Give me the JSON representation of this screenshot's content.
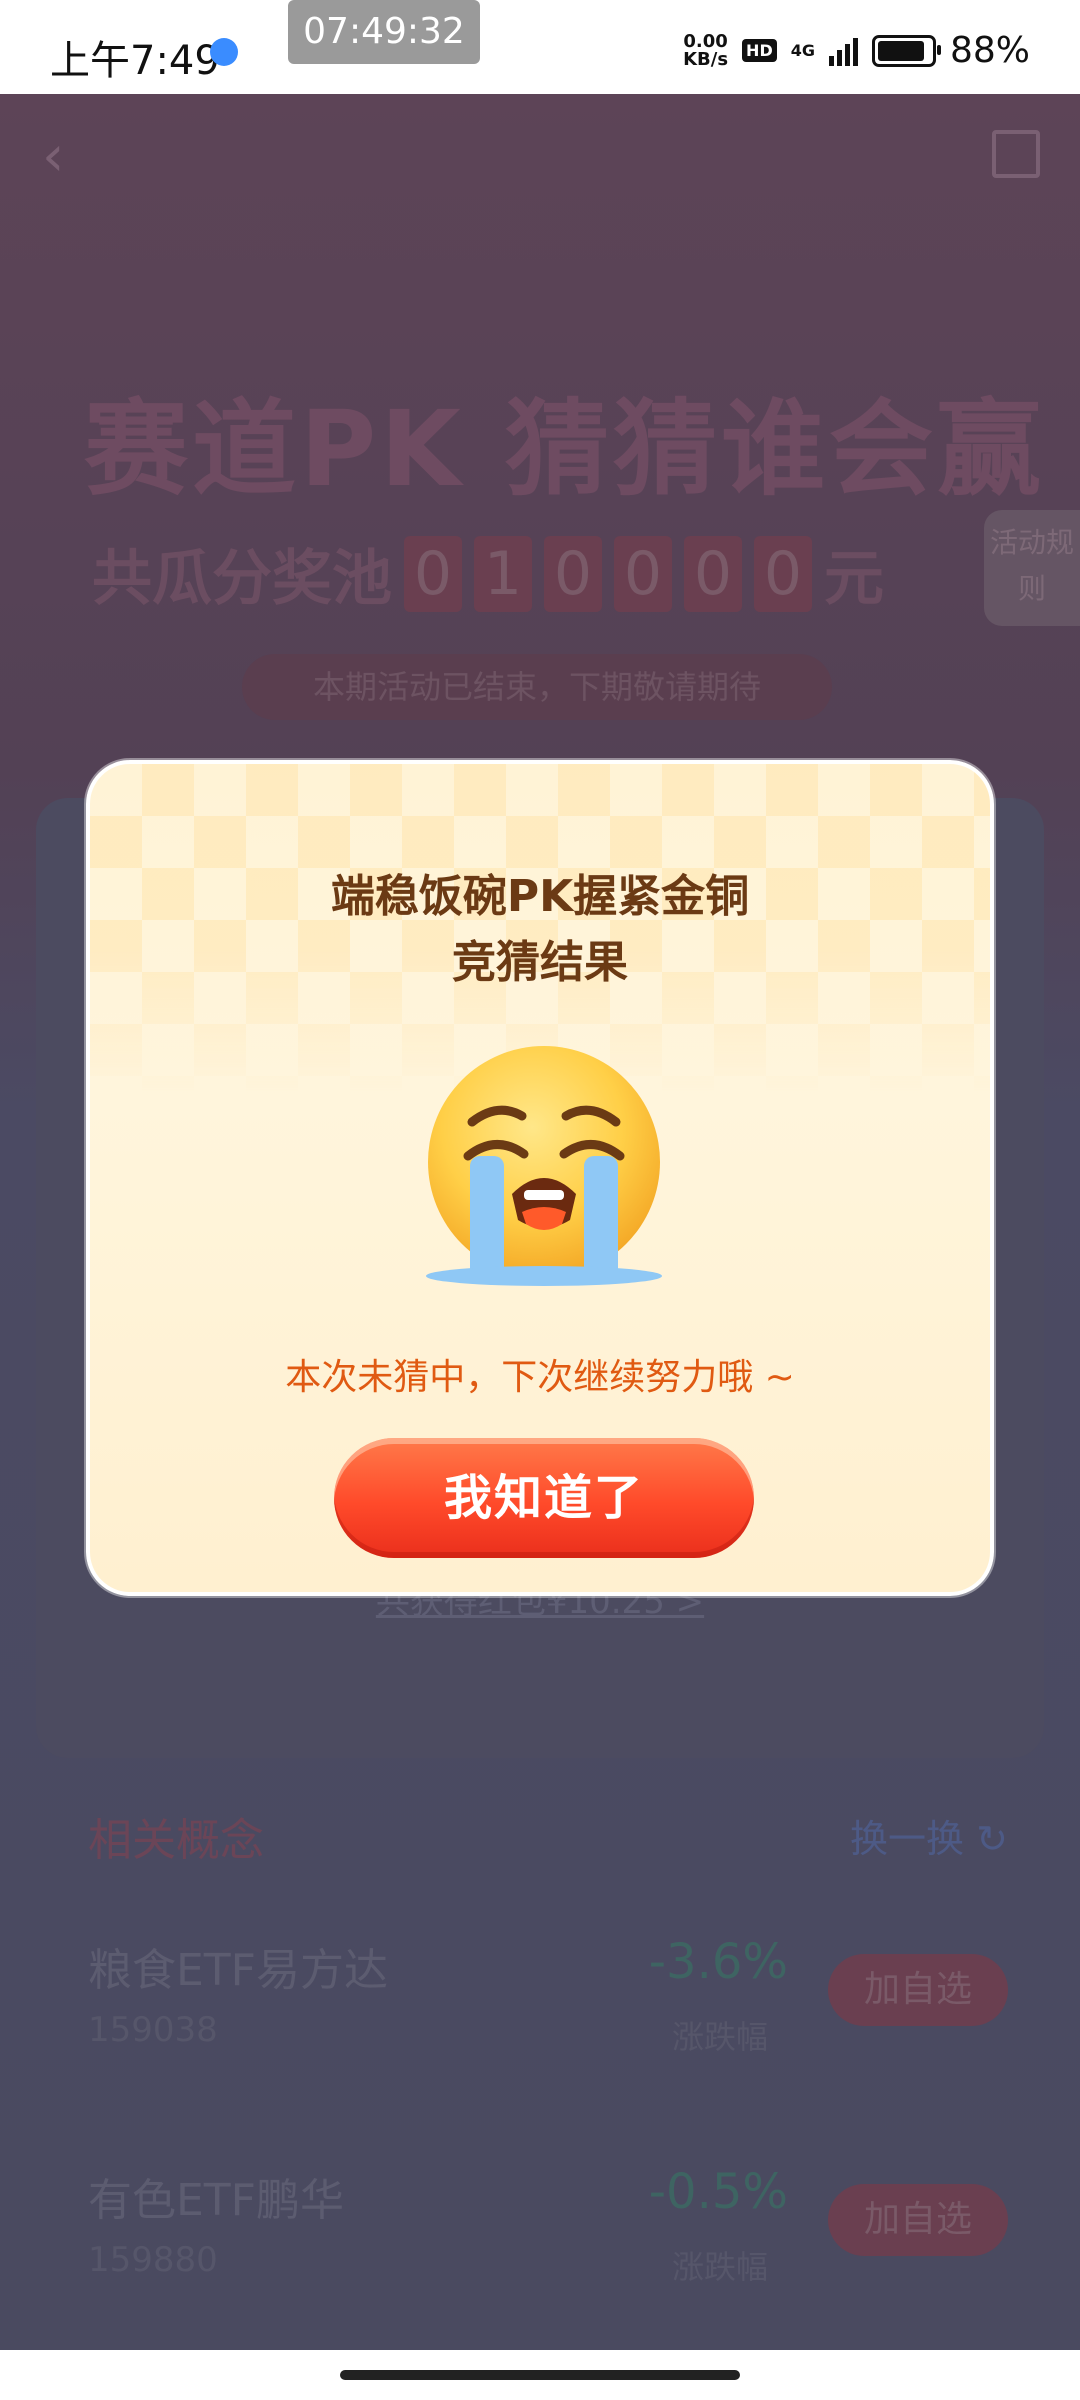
{
  "status_bar": {
    "time": "上午7:49",
    "clock_overlay": "07:49:32",
    "net_speed_value": "0.00",
    "net_speed_unit": "KB/s",
    "hd": "HD",
    "network": "4G",
    "battery_percent_text": "88%",
    "battery_level": 0.88
  },
  "background_page": {
    "brand": "",
    "title": "赛道PK 猜猜谁会赢",
    "pool_label": "共瓜分奖池",
    "pool_digits": [
      "0",
      "1",
      "0",
      "0",
      "0",
      "0"
    ],
    "pool_unit": "元",
    "rules_button": "活动规则",
    "ended_notice": "本期活动已结束，下期敬请期待",
    "redbag_link": "共获得红包¥10.25 >",
    "related": {
      "heading": "相关概念",
      "swap_label": "换一换",
      "rows": [
        {
          "name": "粮食ETF易方达",
          "code": "159038",
          "change": "-3.6%",
          "change_label": "涨跌幅",
          "add_label": "加自选"
        },
        {
          "name": "有色ETF鹏华",
          "code": "159880",
          "change": "-0.5%",
          "change_label": "涨跌幅",
          "add_label": "加自选"
        }
      ]
    }
  },
  "modal": {
    "title_line1": "端稳饭碗PK握紧金铜",
    "title_line2": "竞猜结果",
    "emoji": "crying-face-icon",
    "message": "本次未猜中，下次继续努力哦 ~",
    "confirm_label": "我知道了"
  }
}
